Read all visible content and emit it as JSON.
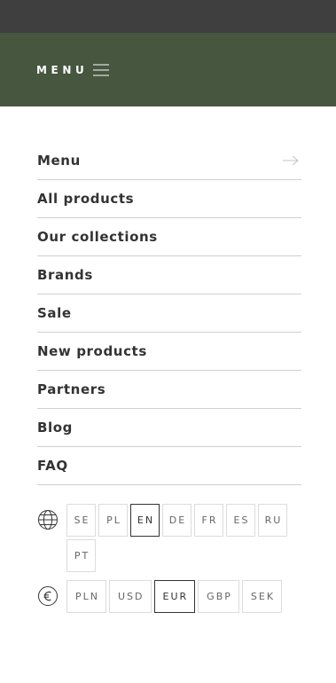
{
  "header": {
    "menu_label": "MENU",
    "background": "#46563f",
    "topbar_color": "#3f3f3f"
  },
  "nav": {
    "items": [
      {
        "label": "Menu",
        "has_arrow": true
      },
      {
        "label": "All products"
      },
      {
        "label": "Our collections"
      },
      {
        "label": "Brands"
      },
      {
        "label": "Sale"
      },
      {
        "label": "New products"
      },
      {
        "label": "Partners"
      },
      {
        "label": "Blog"
      },
      {
        "label": "FAQ"
      }
    ]
  },
  "languages": {
    "icon": "globe-icon",
    "options": [
      "SE",
      "PL",
      "EN",
      "DE",
      "FR",
      "ES",
      "RU",
      "PT"
    ],
    "selected": "EN"
  },
  "currencies": {
    "icon": "euro-icon",
    "options": [
      "PLN",
      "USD",
      "EUR",
      "GBP",
      "SEK"
    ],
    "selected": "EUR"
  }
}
